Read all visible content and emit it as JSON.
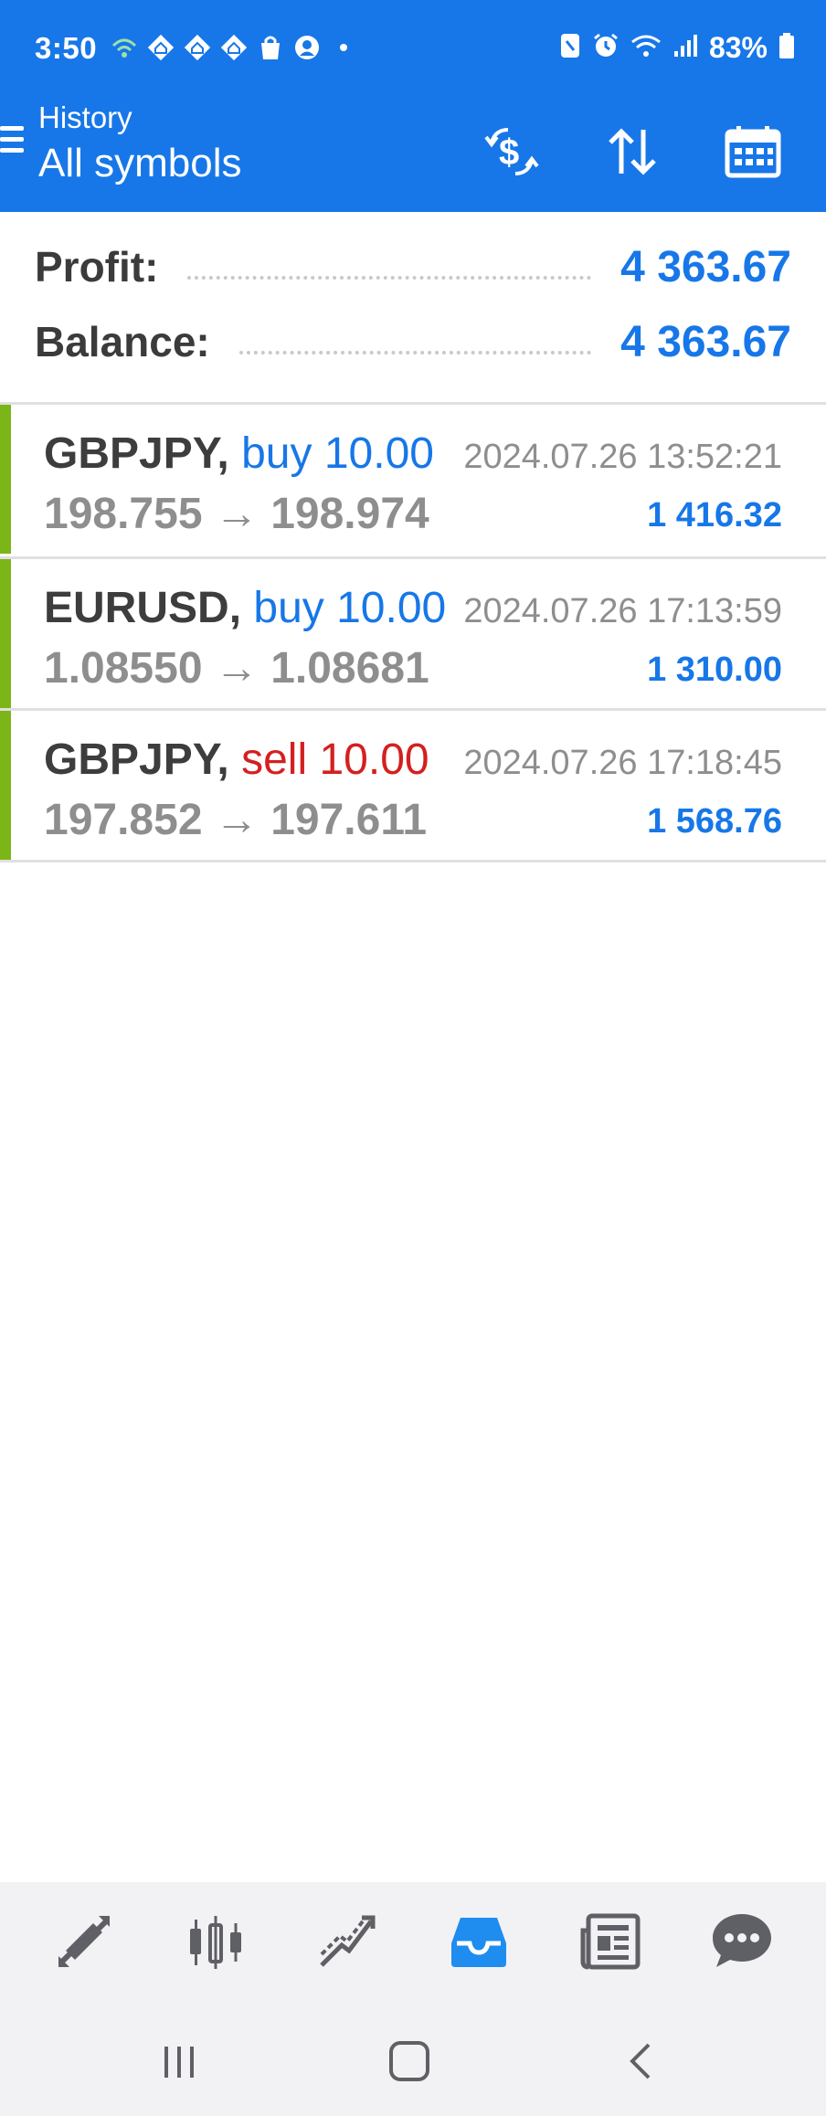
{
  "status_bar": {
    "time": "3:50",
    "battery": "83%"
  },
  "header": {
    "subtitle": "History",
    "title": "All symbols"
  },
  "summary": {
    "profit_label": "Profit:",
    "profit_value": "4 363.67",
    "balance_label": "Balance:",
    "balance_value": "4 363.67"
  },
  "trades": [
    {
      "symbol": "GBPJPY,",
      "side": "buy 10.00",
      "side_type": "buy",
      "open": "198.755",
      "arrow": "→",
      "close": "198.974",
      "time": "2024.07.26 13:52:21",
      "profit": "1 416.32"
    },
    {
      "symbol": "EURUSD,",
      "side": "buy 10.00",
      "side_type": "buy",
      "open": "1.08550",
      "arrow": "→",
      "close": "1.08681",
      "time": "2024.07.26 17:13:59",
      "profit": "1 310.00"
    },
    {
      "symbol": "GBPJPY,",
      "side": "sell 10.00",
      "side_type": "sell",
      "open": "197.852",
      "arrow": "→",
      "close": "197.611",
      "time": "2024.07.26 17:18:45",
      "profit": "1 568.76"
    }
  ],
  "bottom_nav": {
    "items": [
      "quotes-icon",
      "chart-icon",
      "trade-icon",
      "history-icon",
      "news-icon",
      "chat-icon"
    ],
    "active": "history-icon"
  },
  "colors": {
    "primary": "#1777e8",
    "sell": "#d42020",
    "profit_bar": "#7cb518",
    "muted": "#8e8e8e"
  }
}
